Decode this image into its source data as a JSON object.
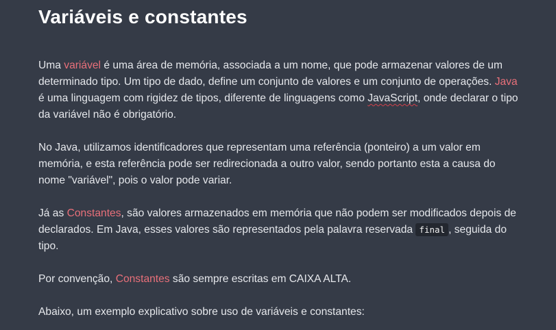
{
  "heading": "Variáveis e constantes",
  "p1": {
    "before": "Uma ",
    "term1": "variável",
    "mid": " é uma área de memória, associada a um nome, que pode armazenar valores de um determinado tipo. Um tipo de dado, define um conjunto de valores e um conjunto de operações. ",
    "term2": "Java",
    "mid2": " é uma linguagem com rigidez de tipos, diferente de linguagens como ",
    "js": "JavaScript",
    "after": ", onde declarar o tipo da variável não é obrigatório."
  },
  "p2": {
    "text": "No Java, utilizamos identificadores que representam uma referência (ponteiro) a um valor em memória, e esta referência pode ser redirecionada a outro valor, sendo portanto esta a causa do nome \"variável\", pois o valor pode variar."
  },
  "p3": {
    "before": "Já as ",
    "term": "Constantes",
    "mid": ", são valores armazenados em memória que não podem ser modificados depois de declarados. Em Java, esses valores são representados pela palavra reservada ",
    "code": "final",
    "after": ", seguida do tipo."
  },
  "p4": {
    "before": "Por convenção, ",
    "term": "Constantes",
    "after": " são sempre escritas em CAIXA ALTA."
  },
  "p5": {
    "text": "Abaixo, um exemplo explicativo sobre uso de variáveis e constantes:"
  },
  "colors": {
    "background": "#353b47",
    "term_accent": "#e9707a",
    "spellcheck_underline": "#d6424c"
  }
}
